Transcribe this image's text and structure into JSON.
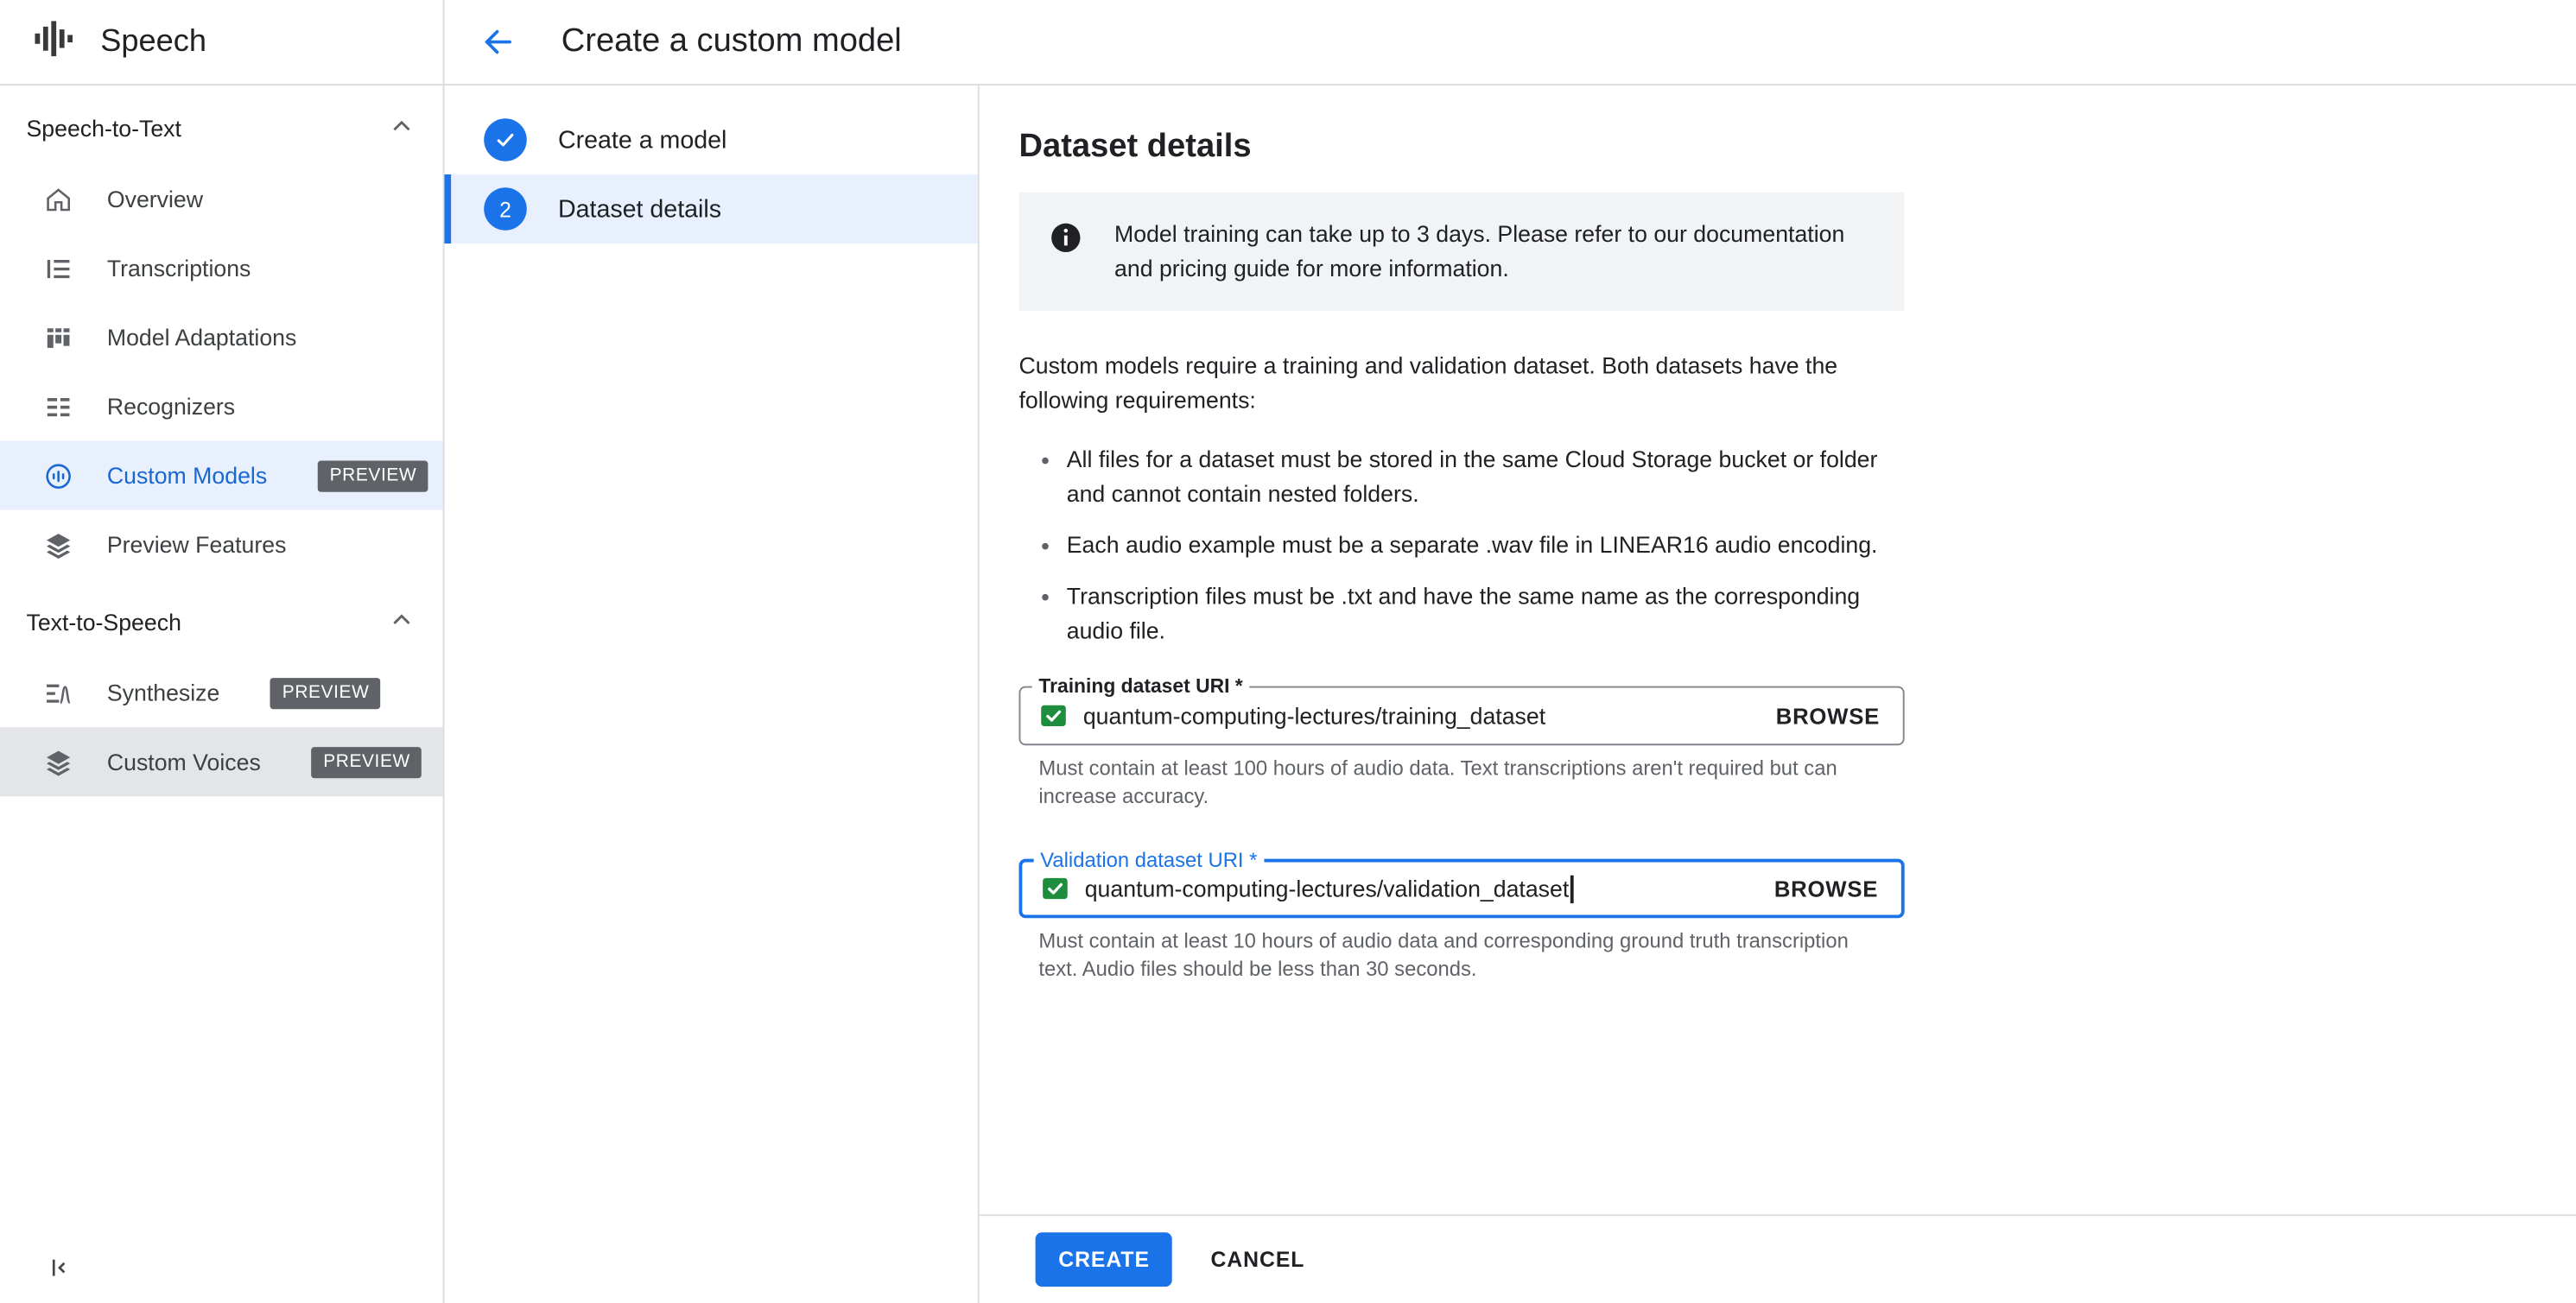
{
  "colors": {
    "accent": "#1a73e8",
    "selected_text": "#1967d2",
    "selected_bg": "#e8f0fe",
    "badge_bg": "#5f6368",
    "storage_icon_green": "#1e8e3e",
    "banner_bg": "#f1f3f4"
  },
  "app": {
    "title": "Speech"
  },
  "sidebar": {
    "sections": [
      {
        "label": "Speech-to-Text",
        "items": [
          {
            "label": "Overview"
          },
          {
            "label": "Transcriptions"
          },
          {
            "label": "Model Adaptations"
          },
          {
            "label": "Recognizers"
          },
          {
            "label": "Custom Models",
            "badge": "PREVIEW",
            "selected": true
          },
          {
            "label": "Preview Features"
          }
        ]
      },
      {
        "label": "Text-to-Speech",
        "items": [
          {
            "label": "Synthesize",
            "badge": "PREVIEW"
          },
          {
            "label": "Custom Voices",
            "badge": "PREVIEW",
            "highlighted": true
          }
        ]
      }
    ]
  },
  "header": {
    "title": "Create a custom model"
  },
  "wizard": {
    "steps": [
      {
        "label": "Create a model",
        "state": "complete"
      },
      {
        "number": "2",
        "label": "Dataset details",
        "state": "active"
      }
    ]
  },
  "main": {
    "title": "Dataset details",
    "info_banner": "Model training can take up to 3 days. Please refer to our documentation and pricing guide for more information.",
    "intro": "Custom models require a training and validation dataset. Both datasets have the following requirements:",
    "requirements": [
      "All files for a dataset must be stored in the same Cloud Storage bucket or folder and cannot contain nested folders.",
      "Each audio example must be a separate .wav file in LINEAR16 audio encoding.",
      "Transcription files must be .txt and have the same name as the corresponding audio file."
    ],
    "fields": [
      {
        "label": "Training dataset URI *",
        "value": "quantum-computing-lectures/training_dataset",
        "action": "BROWSE",
        "helper": "Must contain at least 100 hours of audio data. Text transcriptions aren't required but can increase accuracy."
      },
      {
        "label": "Validation dataset URI *",
        "value": "quantum-computing-lectures/validation_dataset",
        "action": "BROWSE",
        "helper": "Must contain at least 10 hours of audio data and corresponding ground truth transcription text. Audio files should be less than 30 seconds."
      }
    ],
    "actions": {
      "create": "CREATE",
      "cancel": "CANCEL"
    }
  }
}
